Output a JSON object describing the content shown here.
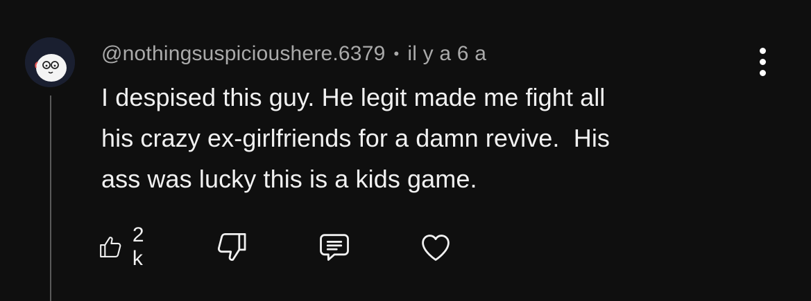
{
  "comment": {
    "handle": "@nothingsuspicioushere.6379",
    "separator": "•",
    "time": "il y a 6 a",
    "text": "I despised this guy. He legit made me fight all\nhis crazy ex-girlfriends for a damn revive.  His\nass was lucky this is a kids game.",
    "avatar": "cartoon-face-avatar"
  },
  "actions": {
    "like_icon": "thumbs-up-icon",
    "like_count": "2 k",
    "dislike_icon": "thumbs-down-icon",
    "reply_icon": "comment-icon",
    "heart_icon": "heart-icon"
  },
  "menu": {
    "icon": "more-vertical-icon"
  },
  "colors": {
    "background": "#0f0f0f",
    "primary_text": "#f1f1f1",
    "secondary_text": "#aaaaaa",
    "thread_line": "#5a5a5a"
  }
}
